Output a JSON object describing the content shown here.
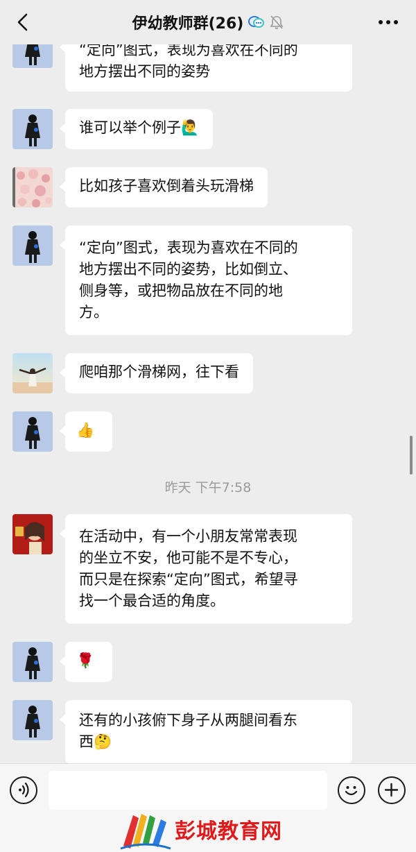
{
  "header": {
    "title": "伊幼教师群(26)",
    "back_icon": "chevron-left-icon",
    "more_icon": "more-dots-icon",
    "multi_device_icon": "chat-bubbles-icon",
    "mute_icon": "bell-off-icon"
  },
  "messages": [
    {
      "sender_avatar": "avatar-boy",
      "text_lines": [
        "“定向”图式，表现为喜欢在不同的",
        "地方摆出不同的姿势"
      ]
    },
    {
      "sender_avatar": "avatar-boy",
      "text_lines": [
        "谁可以举个例子🙋‍♂️"
      ]
    },
    {
      "sender_avatar": "avatar-flowers",
      "text_lines": [
        "比如孩子喜欢倒着头玩滑梯"
      ]
    },
    {
      "sender_avatar": "avatar-boy",
      "text_lines": [
        "“定向”图式，表现为喜欢在不同的",
        "地方摆出不同的姿势，比如倒立、",
        "侧身等，或把物品放在不同的地",
        "方。"
      ]
    },
    {
      "sender_avatar": "avatar-sky",
      "text_lines": [
        "爬咱那个滑梯网，往下看"
      ]
    },
    {
      "sender_avatar": "avatar-boy",
      "text_lines": [
        "👍"
      ]
    },
    {
      "sender_avatar": "avatar-red",
      "text_lines": [
        "在活动中，有一个小朋友常常表现",
        "的坐立不安，他可能不是不专心，",
        "而只是在探索“定向”图式，希望寻",
        "找一个最合适的角度。"
      ]
    },
    {
      "sender_avatar": "avatar-boy",
      "text_lines": [
        "🌹"
      ]
    },
    {
      "sender_avatar": "avatar-boy",
      "text_lines": [
        "还有的小孩俯下身子从两腿间看东",
        "西🤔"
      ]
    }
  ],
  "timestamp": "昨天 下午7:58",
  "input_bar": {
    "voice_icon": "voice-icon",
    "emoji_icon": "smiley-icon",
    "plus_icon": "plus-icon",
    "input_value": ""
  },
  "watermark": {
    "text": "彭城教育网",
    "logo_icon": "books-logo-icon"
  },
  "colors": {
    "background": "#ededed",
    "bubble": "#ffffff",
    "watermark": "#e01a1a"
  }
}
